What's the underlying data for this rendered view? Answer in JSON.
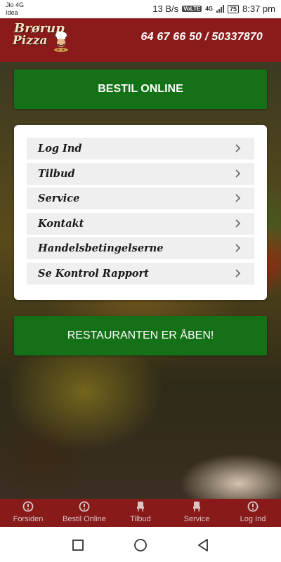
{
  "status_bar": {
    "carrier_line1": "Jio 4G",
    "carrier_line2": "Idea",
    "data_speed": "13 B/s",
    "volte": "VoLTE",
    "network": "4G",
    "battery": "75",
    "time": "8:37 pm"
  },
  "header": {
    "logo_line1": "Brørup",
    "logo_line2": "Pizza",
    "phone": "64 67 66 50 / 50337870"
  },
  "buttons": {
    "order_online": "BESTIL ONLINE",
    "restaurant_status": "RESTAURANTEN ER ÅBEN!"
  },
  "menu": {
    "items": [
      {
        "label": "Log Ind"
      },
      {
        "label": "Tilbud"
      },
      {
        "label": "Service"
      },
      {
        "label": "Kontakt"
      },
      {
        "label": "Handelsbetingelserne"
      },
      {
        "label": "Se Kontrol Rapport"
      }
    ]
  },
  "bottom_nav": {
    "items": [
      {
        "label": "Forsiden",
        "icon": "info-circle-icon"
      },
      {
        "label": "Bestil Online",
        "icon": "info-circle-icon"
      },
      {
        "label": "Tilbud",
        "icon": "chair-icon"
      },
      {
        "label": "Service",
        "icon": "chair-icon"
      },
      {
        "label": "Log Ind",
        "icon": "info-circle-icon"
      }
    ]
  },
  "colors": {
    "header_bg": "#8b1b1b",
    "button_green": "#157117",
    "nav_bg": "#881a1a"
  }
}
